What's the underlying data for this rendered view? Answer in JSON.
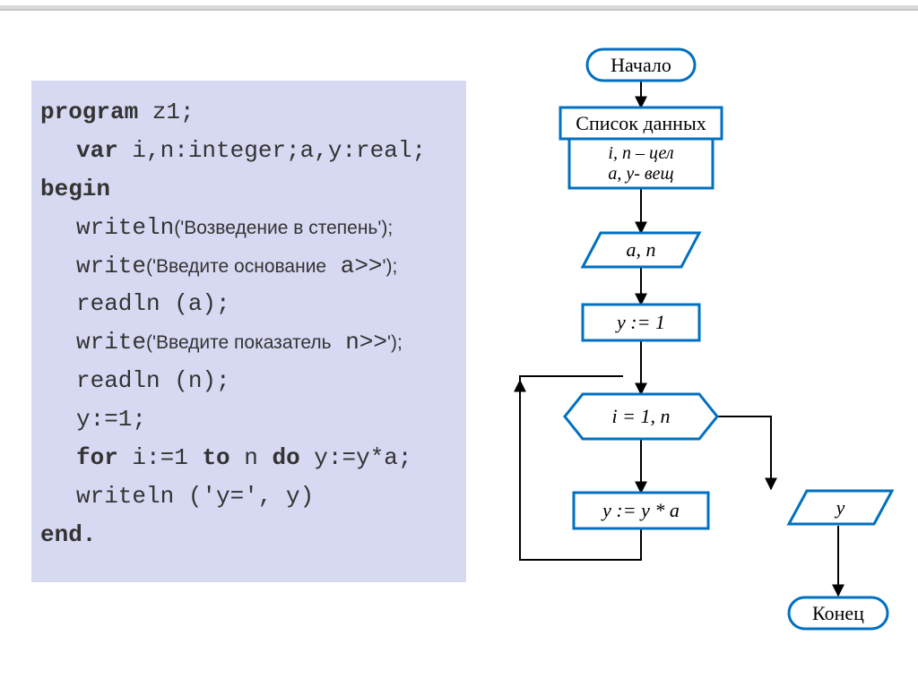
{
  "code": {
    "l1_a": "program",
    "l1_b": " z1;",
    "l2_a": "var",
    "l2_b": " i,n:integer;a,y:real;",
    "l3": "begin",
    "l4_a": "writeln",
    "l4_b": "('Возведение в степень');",
    "l5_a": "write",
    "l5_b": "('Введите основание",
    "l5_c": " a>>",
    "l5_d": "');",
    "l6": "readln (a);",
    "l7_a": "write",
    "l7_b": "('Введите показатель",
    "l7_c": " n>>",
    "l7_d": "');",
    "l8": "readln (n);",
    "l9": "y:=1;",
    "l10_a": "for",
    "l10_b": " i:=1 ",
    "l10_c": "to",
    "l10_d": " n ",
    "l10_e": "do",
    "l10_f": " y:=y*a;",
    "l11": "writeln ('y=', y)",
    "l12": "end."
  },
  "flow": {
    "start": "Начало",
    "data_list_title": "Список данных",
    "data_list_body_1": "i, n – цел",
    "data_list_body_2": "a, y- вещ",
    "input": "a, n",
    "assign1": "y := 1",
    "loop": "i = 1, n",
    "body": "y := y * a",
    "output": "y",
    "end": "Конец"
  }
}
